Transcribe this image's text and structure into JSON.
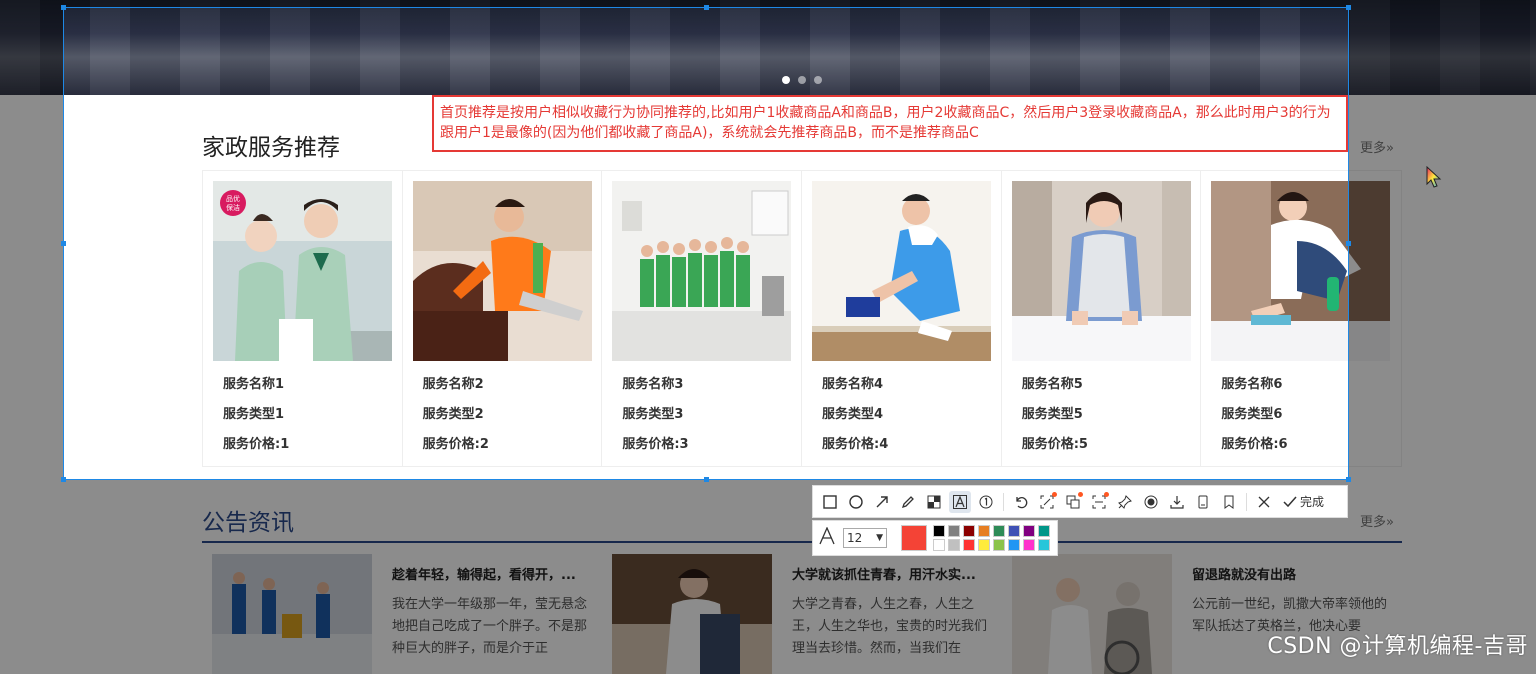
{
  "banner": {
    "slides": 3,
    "active_slide": 1
  },
  "recommend": {
    "title": "家政服务推荐",
    "more": "更多»",
    "cards": [
      {
        "name": "服务名称1",
        "type": "服务类型1",
        "price": "服务价格:1",
        "badge": "品优保洁"
      },
      {
        "name": "服务名称2",
        "type": "服务类型2",
        "price": "服务价格:2"
      },
      {
        "name": "服务名称3",
        "type": "服务类型3",
        "price": "服务价格:3"
      },
      {
        "name": "服务名称4",
        "type": "服务类型4",
        "price": "服务价格:4"
      },
      {
        "name": "服务名称5",
        "type": "服务类型5",
        "price": "服务价格:5"
      },
      {
        "name": "服务名称6",
        "type": "服务类型6",
        "price": "服务价格:6"
      }
    ]
  },
  "annotation": {
    "text": "首页推荐是按用户相似收藏行为协同推荐的,比如用户1收藏商品A和商品B，用户2收藏商品C，然后用户3登录收藏商品A，那么此时用户3的行为跟用户1是最像的(因为他们都收藏了商品A)，系统就会先推荐商品B，而不是推荐商品C",
    "color": "#e53935"
  },
  "notice": {
    "title": "公告资讯",
    "more": "更多»",
    "items": [
      {
        "title": "趁着年轻，输得起，看得开，...",
        "body": "我在大学一年级那一年，莹无悬念地把自己吃成了一个胖子。不是那种巨大的胖子，而是介于正"
      },
      {
        "title": "大学就该抓住青春，用汗水实...",
        "body": "大学之青春，人生之春，人生之王，人生之华也，宝贵的时光我们理当去珍惜。然而，当我们在"
      },
      {
        "title": "留退路就没有出路",
        "body": "公元前一世纪，凯撒大帝率领他的军队抵达了英格兰，他决心要"
      }
    ]
  },
  "toolbar": {
    "tools": [
      "rect-icon",
      "ellipse-icon",
      "arrow-icon",
      "pencil-icon",
      "mosaic-icon",
      "text-icon",
      "number-icon",
      "undo-icon",
      "ocr-icon",
      "translate-icon",
      "scan-icon",
      "pin-icon",
      "record-icon",
      "download-icon",
      "save-icon",
      "bookmark-icon",
      "close-icon"
    ],
    "done_label": "完成",
    "font_size": "12",
    "current_color": "#f44336",
    "palette": [
      "#000000",
      "#808080",
      "#8b0000",
      "#e67e22",
      "#2e8b57",
      "#3f51b5",
      "#800080",
      "#009688",
      "#ffffff",
      "#c0c0c0",
      "#ff3333",
      "#ffeb3b",
      "#8bc34a",
      "#2196f3",
      "#ff33cc",
      "#26c6da"
    ]
  },
  "watermark": "CSDN @计算机编程-吉哥"
}
